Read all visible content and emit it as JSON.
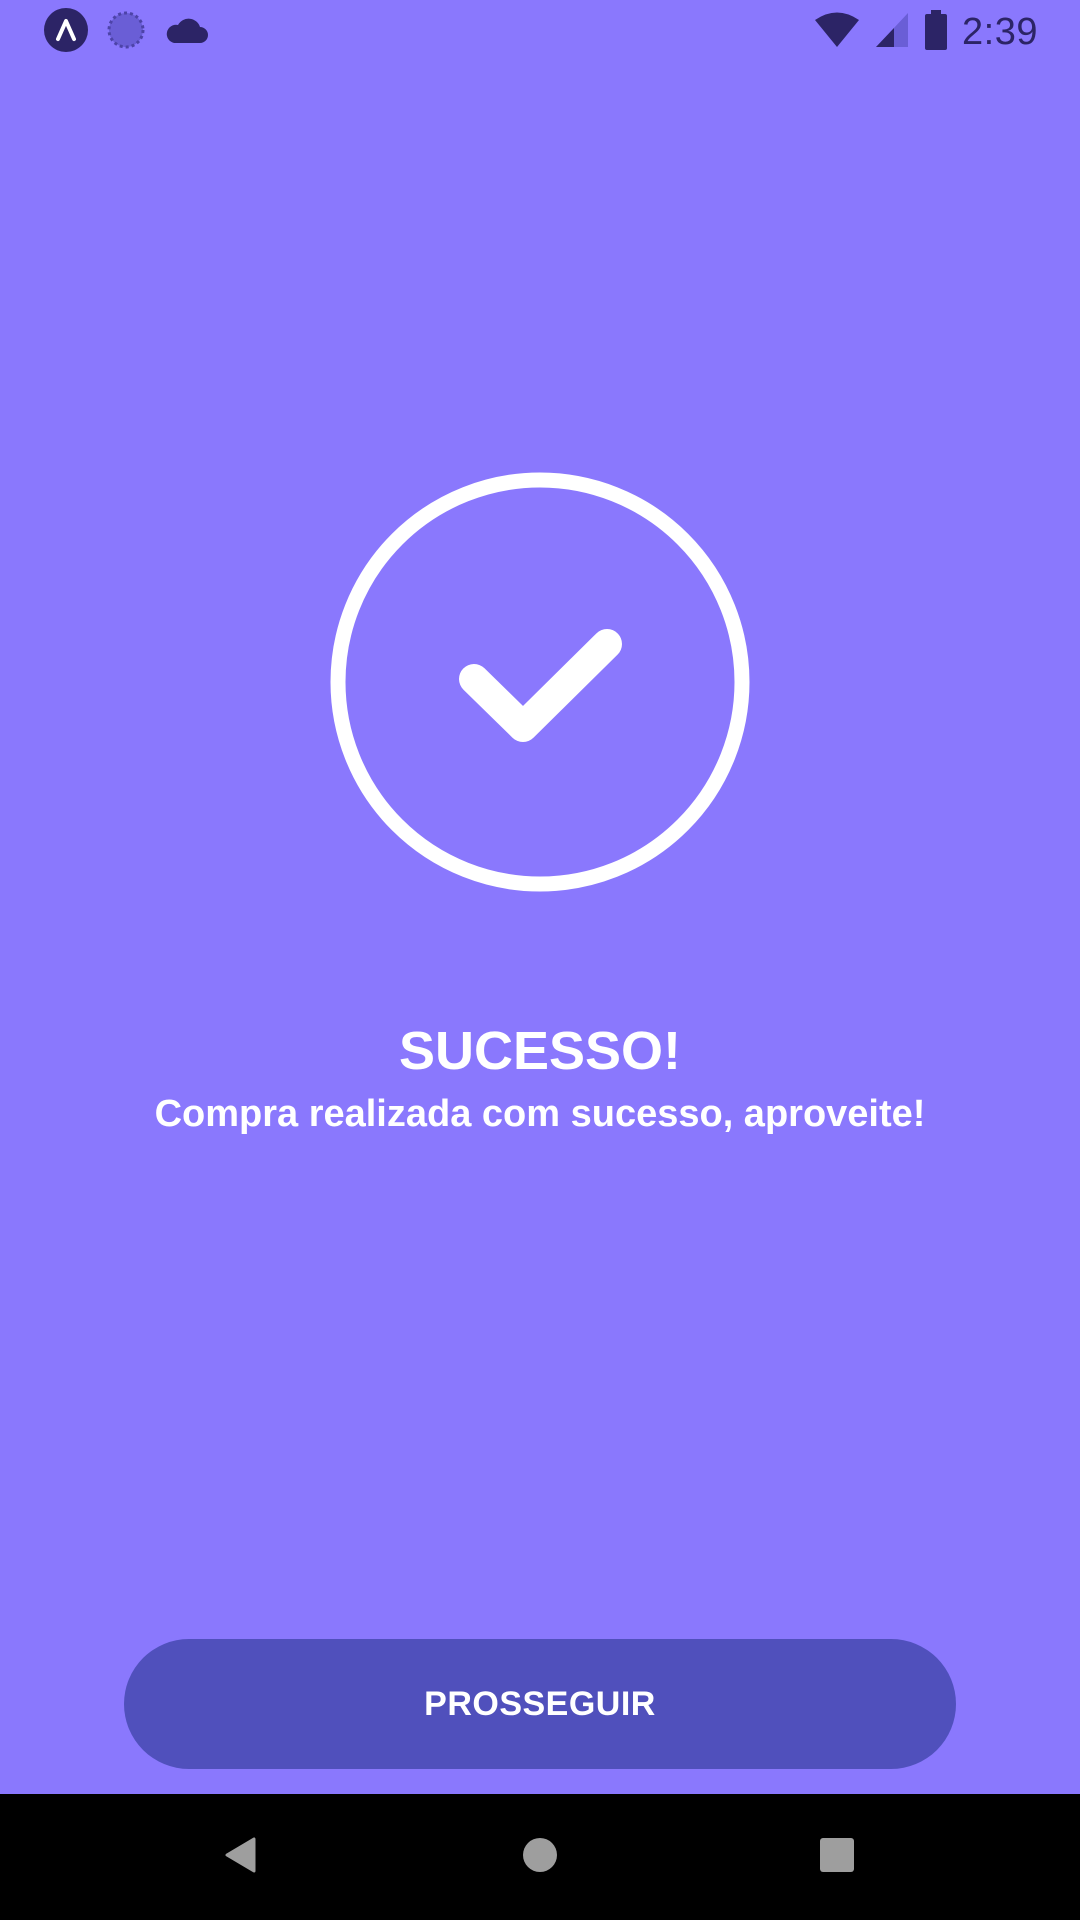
{
  "status_bar": {
    "time": "2:39",
    "left_icons": [
      "app-launcher-icon",
      "loading-icon",
      "cloud-icon"
    ],
    "right_icons": [
      "wifi-icon",
      "signal-icon",
      "battery-icon"
    ]
  },
  "success": {
    "title": "SUCESSO!",
    "message": "Compra realizada com sucesso, aproveite!"
  },
  "actions": {
    "proceed_label": "PROSSEGUIR"
  },
  "nav_bar": {
    "buttons": [
      "back-icon",
      "home-icon",
      "recents-icon"
    ]
  },
  "colors": {
    "background": "#8A78FD",
    "button": "#5050BC",
    "status_icons": "#2C2466",
    "text": "#FFFFFF"
  }
}
